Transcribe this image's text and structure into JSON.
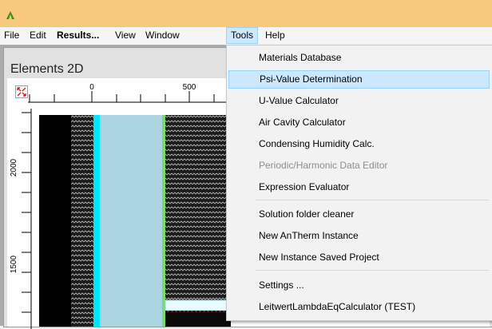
{
  "menubar": {
    "items": [
      {
        "label": "File"
      },
      {
        "label": "Edit"
      },
      {
        "label": "Results..."
      },
      {
        "label": "View"
      },
      {
        "label": "Window"
      },
      {
        "label": "Tools"
      },
      {
        "label": "Help"
      }
    ]
  },
  "child_window": {
    "title": "Elements 2D",
    "ruler_top_labels": [
      "0",
      "500"
    ],
    "ruler_left_labels": [
      "2000",
      "1500"
    ]
  },
  "tools_menu": {
    "items": [
      {
        "label": "Materials Database"
      },
      {
        "label": "Psi-Value Determination"
      },
      {
        "label": "U-Value Calculator"
      },
      {
        "label": "Air Cavity Calculator"
      },
      {
        "label": "Condensing Humidity Calc."
      },
      {
        "label": "Periodic/Harmonic Data Editor"
      },
      {
        "label": "Expression Evaluator"
      },
      {
        "label": "Solution folder cleaner"
      },
      {
        "label": "New AnTherm Instance"
      },
      {
        "label": "New Instance Saved Project"
      },
      {
        "label": "Settings ..."
      },
      {
        "label": "LeitwertLambdaEqCalculator (TEST)"
      }
    ]
  },
  "colors": {
    "title_bar": "#f6c97f",
    "menu_highlight": "#cce8ff",
    "cyan_layer": "#00e5ff",
    "light_blue_layer": "#a9d4e0",
    "green_edge": "#7fd86b"
  }
}
